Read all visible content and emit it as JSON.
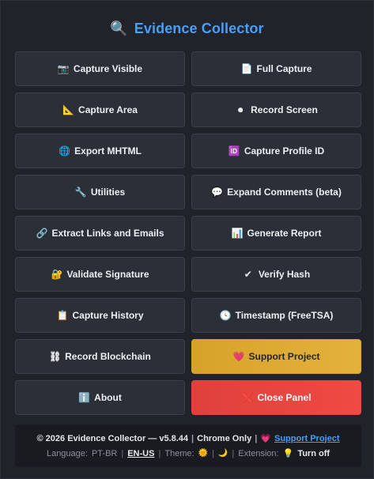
{
  "header": {
    "icon": "magnifier-icon",
    "icon_glyph": "🔍",
    "title": "Evidence Collector",
    "title_color": "#4a9ef5"
  },
  "buttons": [
    {
      "name": "capture-visible-button",
      "icon": "camera-icon",
      "glyph": "📷",
      "label": "Capture Visible"
    },
    {
      "name": "full-capture-button",
      "icon": "document-icon",
      "glyph": "📄",
      "label": "Full Capture"
    },
    {
      "name": "capture-area-button",
      "icon": "triangle-ruler-icon",
      "glyph": "📐",
      "label": "Capture Area"
    },
    {
      "name": "record-screen-button",
      "icon": "record-icon",
      "glyph": "⏺",
      "label": "Record Screen"
    },
    {
      "name": "export-mhtml-button",
      "icon": "globe-icon",
      "glyph": "🌐",
      "label": "Export MHTML"
    },
    {
      "name": "capture-profile-id-button",
      "icon": "id-icon",
      "glyph": "🆔",
      "label": "Capture Profile ID"
    },
    {
      "name": "utilities-button",
      "icon": "wrench-icon",
      "glyph": "🔧",
      "label": "Utilities"
    },
    {
      "name": "expand-comments-button",
      "icon": "speech-bubble-icon",
      "glyph": "💬",
      "label": "Expand Comments (beta)"
    },
    {
      "name": "extract-links-button",
      "icon": "link-icon",
      "glyph": "🔗",
      "label": "Extract Links and Emails"
    },
    {
      "name": "generate-report-button",
      "icon": "bar-chart-icon",
      "glyph": "📊",
      "label": "Generate Report"
    },
    {
      "name": "validate-signature-button",
      "icon": "lock-key-icon",
      "glyph": "🔐",
      "label": "Validate Signature"
    },
    {
      "name": "verify-hash-button",
      "icon": "checkmark-icon",
      "glyph": "✔",
      "label": "Verify Hash"
    },
    {
      "name": "capture-history-button",
      "icon": "clipboard-icon",
      "glyph": "📋",
      "label": "Capture History"
    },
    {
      "name": "timestamp-button",
      "icon": "clock-icon",
      "glyph": "🕓",
      "label": "Timestamp (FreeTSA)"
    },
    {
      "name": "record-blockchain-button",
      "icon": "chain-icon",
      "glyph": "⛓",
      "label": "Record Blockchain"
    },
    {
      "name": "support-project-button",
      "icon": "heart-icon",
      "glyph": "💗",
      "label": "Support Project",
      "variant": "support"
    },
    {
      "name": "about-button",
      "icon": "info-icon",
      "glyph": "ℹ️",
      "label": "About"
    },
    {
      "name": "close-panel-button",
      "icon": "close-x-icon",
      "glyph": "❌",
      "label": "Close Panel",
      "variant": "close"
    }
  ],
  "footer": {
    "copyright": "© 2026 Evidence Collector — v5.8.44",
    "browser": "Chrome Only",
    "heart_glyph": "💗",
    "support_link": "Support Project",
    "language_label": "Language:",
    "lang_pt": "PT-BR",
    "lang_en": "EN-US",
    "theme_label": "Theme:",
    "theme_light_glyph": "🌞",
    "theme_dark_glyph": "🌙",
    "extension_label": "Extension:",
    "bulb_glyph": "💡",
    "turn_off": "Turn off"
  },
  "colors": {
    "background": "#20232a",
    "button": "#2b2f37",
    "support": "#e0ad36",
    "close": "#e8463f",
    "link": "#4a9ef5"
  }
}
